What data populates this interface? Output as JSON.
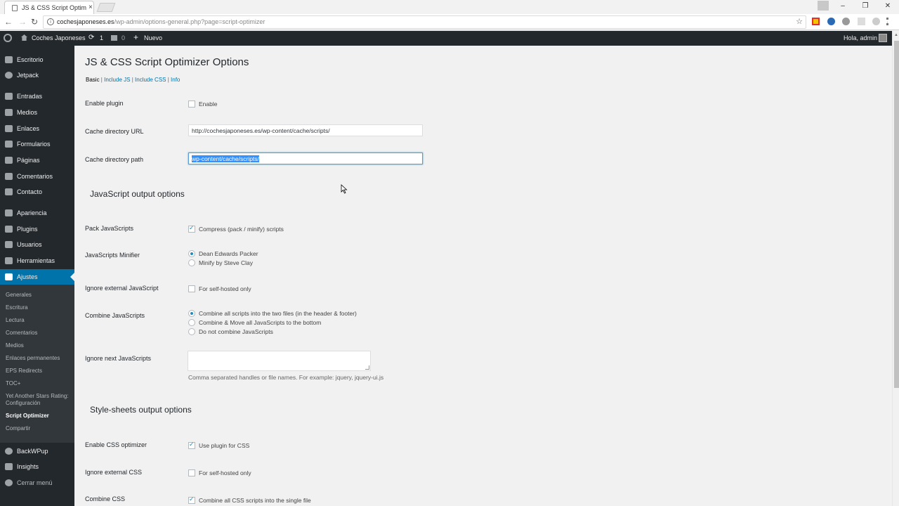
{
  "browser": {
    "tab_title": "JS & CSS Script Optimize",
    "tab_close": "×",
    "url_host": "cochesjaponeses.es",
    "url_path": "/wp-admin/options-general.php?page=script-optimizer",
    "window_minimize": "–",
    "window_maximize": "❐",
    "window_close": "✕",
    "star": "☆",
    "back": "←",
    "forward": "→",
    "reload": "↻",
    "info": "i"
  },
  "adminbar": {
    "site_name": "Coches Japoneses",
    "updates_count": "1",
    "comments_count": "0",
    "new_label": "Nuevo",
    "greeting": "Hola, admin"
  },
  "sidebar": {
    "items": [
      {
        "label": "Escritorio",
        "icon": "dashboard-icon"
      },
      {
        "label": "Jetpack",
        "icon": "jetpack-icon"
      },
      {
        "label": "Entradas",
        "icon": "pin-icon"
      },
      {
        "label": "Medios",
        "icon": "media-icon"
      },
      {
        "label": "Enlaces",
        "icon": "links-icon"
      },
      {
        "label": "Formularios",
        "icon": "forms-icon"
      },
      {
        "label": "Páginas",
        "icon": "pages-icon"
      },
      {
        "label": "Comentarios",
        "icon": "comments-icon"
      },
      {
        "label": "Contacto",
        "icon": "mail-icon"
      },
      {
        "label": "Apariencia",
        "icon": "brush-icon"
      },
      {
        "label": "Plugins",
        "icon": "plugin-icon"
      },
      {
        "label": "Usuarios",
        "icon": "users-icon"
      },
      {
        "label": "Herramientas",
        "icon": "tools-icon"
      },
      {
        "label": "Ajustes",
        "icon": "settings-icon"
      },
      {
        "label": "BackWPup",
        "icon": "backup-icon"
      },
      {
        "label": "Insights",
        "icon": "insights-icon"
      },
      {
        "label": "Cerrar menú",
        "icon": "collapse-icon"
      }
    ],
    "submenu": [
      "Generales",
      "Escritura",
      "Lectura",
      "Comentarios",
      "Medios",
      "Enlaces permanentes",
      "EPS Redirects",
      "TOC+",
      "Yet Another Stars Rating: Configuración",
      "Script Optimizer",
      "Compartir"
    ]
  },
  "page": {
    "title": "JS & CSS Script Optimizer Options",
    "tabs": [
      "Basic",
      "Include JS",
      "Include CSS",
      "Info"
    ],
    "separator": "|",
    "rows": {
      "enable_plugin": {
        "label": "Enable plugin",
        "option": "Enable",
        "checked": false
      },
      "cache_url": {
        "label": "Cache directory URL",
        "value": "http://cochesjaponeses.es/wp-content/cache/scripts/"
      },
      "cache_path": {
        "label": "Cache directory path",
        "value": "wp-content/cache/scripts/"
      }
    },
    "js_section": {
      "title": "JavaScript output options",
      "pack": {
        "label": "Pack JavaScripts",
        "option": "Compress (pack / minify) scripts",
        "checked": true
      },
      "minifier": {
        "label": "JavaScripts Minifier",
        "options": [
          "Dean Edwards Packer",
          "Minify by Steve Clay"
        ],
        "selected": 0
      },
      "ignore_external": {
        "label": "Ignore external JavaScript",
        "option": "For self-hosted only",
        "checked": false
      },
      "combine": {
        "label": "Combine JavaScripts",
        "options": [
          "Combine all scripts into the two files (in the header & footer)",
          "Combine & Move all JavaScripts to the bottom",
          "Do not combine JavaScripts"
        ],
        "selected": 0
      },
      "ignore_next": {
        "label": "Ignore next JavaScripts",
        "value": "",
        "description": "Comma separated handles or file names. For example: jquery, jquery-ui.js"
      }
    },
    "css_section": {
      "title": "Style-sheets output options",
      "enable": {
        "label": "Enable CSS optimizer",
        "option": "Use plugin for CSS",
        "checked": true
      },
      "ignore_external": {
        "label": "Ignore external CSS",
        "option": "For self-hosted only",
        "checked": false
      },
      "combine": {
        "label": "Combine CSS",
        "option": "Combine all CSS scripts into the single file",
        "checked": true
      }
    }
  }
}
